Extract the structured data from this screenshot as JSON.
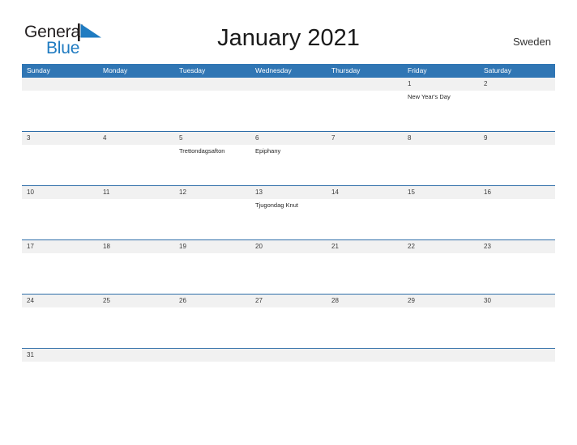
{
  "brand": {
    "name_part1": "General",
    "name_part2": "Blue",
    "flag_icon": "blue-triangle-flag-icon",
    "color_dark": "#231f20",
    "color_blue": "#1f7bc1"
  },
  "header": {
    "title": "January 2021",
    "country": "Sweden"
  },
  "theme": {
    "header_blue": "#3076B4",
    "line_blue": "#2E6DA8",
    "date_band_gray": "#F1F1F1",
    "text_dark": "#1a1a1a"
  },
  "calendar": {
    "weekdays": [
      "Sunday",
      "Monday",
      "Tuesday",
      "Wednesday",
      "Thursday",
      "Friday",
      "Saturday"
    ],
    "weeks": [
      {
        "days": [
          {
            "date": "",
            "events": []
          },
          {
            "date": "",
            "events": []
          },
          {
            "date": "",
            "events": []
          },
          {
            "date": "",
            "events": []
          },
          {
            "date": "",
            "events": []
          },
          {
            "date": "1",
            "events": [
              "New Year's Day"
            ]
          },
          {
            "date": "2",
            "events": []
          }
        ]
      },
      {
        "days": [
          {
            "date": "3",
            "events": []
          },
          {
            "date": "4",
            "events": []
          },
          {
            "date": "5",
            "events": [
              "Trettondagsafton"
            ]
          },
          {
            "date": "6",
            "events": [
              "Epiphany"
            ]
          },
          {
            "date": "7",
            "events": []
          },
          {
            "date": "8",
            "events": []
          },
          {
            "date": "9",
            "events": []
          }
        ]
      },
      {
        "days": [
          {
            "date": "10",
            "events": []
          },
          {
            "date": "11",
            "events": []
          },
          {
            "date": "12",
            "events": []
          },
          {
            "date": "13",
            "events": [
              "Tjugondag Knut"
            ]
          },
          {
            "date": "14",
            "events": []
          },
          {
            "date": "15",
            "events": []
          },
          {
            "date": "16",
            "events": []
          }
        ]
      },
      {
        "days": [
          {
            "date": "17",
            "events": []
          },
          {
            "date": "18",
            "events": []
          },
          {
            "date": "19",
            "events": []
          },
          {
            "date": "20",
            "events": []
          },
          {
            "date": "21",
            "events": []
          },
          {
            "date": "22",
            "events": []
          },
          {
            "date": "23",
            "events": []
          }
        ]
      },
      {
        "days": [
          {
            "date": "24",
            "events": []
          },
          {
            "date": "25",
            "events": []
          },
          {
            "date": "26",
            "events": []
          },
          {
            "date": "27",
            "events": []
          },
          {
            "date": "28",
            "events": []
          },
          {
            "date": "29",
            "events": []
          },
          {
            "date": "30",
            "events": []
          }
        ]
      },
      {
        "days": [
          {
            "date": "31",
            "events": []
          },
          {
            "date": "",
            "events": []
          },
          {
            "date": "",
            "events": []
          },
          {
            "date": "",
            "events": []
          },
          {
            "date": "",
            "events": []
          },
          {
            "date": "",
            "events": []
          },
          {
            "date": "",
            "events": []
          }
        ]
      }
    ]
  }
}
